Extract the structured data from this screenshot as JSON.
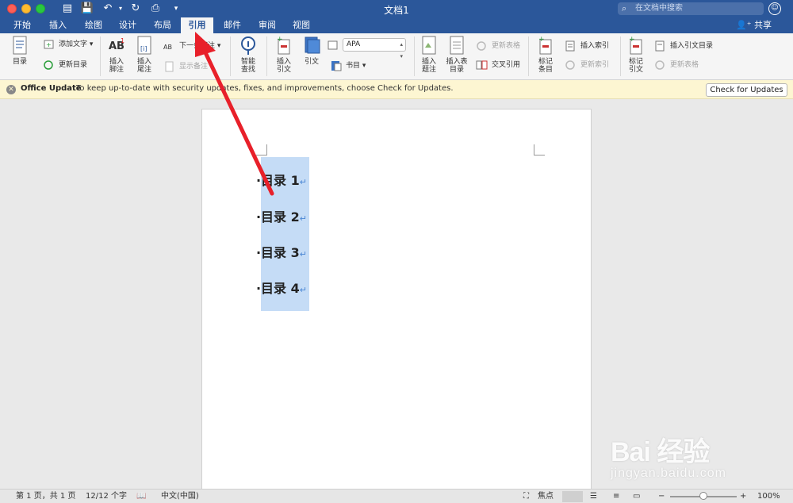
{
  "window": {
    "title": "文档1"
  },
  "search": {
    "placeholder": "在文档中搜索"
  },
  "tabs": [
    {
      "label": "开始"
    },
    {
      "label": "插入"
    },
    {
      "label": "绘图"
    },
    {
      "label": "设计"
    },
    {
      "label": "布局"
    },
    {
      "label": "引用"
    },
    {
      "label": "邮件"
    },
    {
      "label": "审阅"
    },
    {
      "label": "视图"
    }
  ],
  "share_label": "共享",
  "ribbon": {
    "toc": "目录",
    "add_text": "添加文字",
    "update_toc": "更新目录",
    "insert_footnote": "插入\n脚注",
    "insert_endnote": "插入\n尾注",
    "next_footnote": "下一条脚注",
    "show_notes": "显示备注",
    "smart_lookup": "智能\n查找",
    "insert_citation": "插入\n引文",
    "citations": "引文",
    "style_value": "APA",
    "bibliography": "书目",
    "insert_caption": "插入\n题注",
    "insert_table_of_figures": "插入表\n目录",
    "update_table": "更新表格",
    "cross_reference": "交叉引用",
    "mark_entry": "标记\n条目",
    "insert_index": "插入索引",
    "update_index": "更新索引",
    "mark_citation": "标记\n引文",
    "insert_toa": "插入引文目录",
    "update_toa": "更新表格"
  },
  "update_bar": {
    "title": "Office Update",
    "message": "To keep up-to-date with security updates, fixes, and improvements, choose Check for Updates.",
    "button": "Check for Updates"
  },
  "document": {
    "lines": [
      "目录 1",
      "目录 2",
      "目录 3",
      "目录 4"
    ]
  },
  "status": {
    "page": "第 1 页，共 1 页",
    "words": "12/12 个字",
    "language": "中文(中国)",
    "focus": "焦点",
    "zoom": "100%",
    "zoom_level": 0.5
  },
  "watermark": {
    "brand": "Bai 经验",
    "url": "jingyan.baidu.com"
  },
  "colors": {
    "accent": "#2b579a",
    "selection": "#c5dcf6",
    "arrow": "#e8202a"
  }
}
